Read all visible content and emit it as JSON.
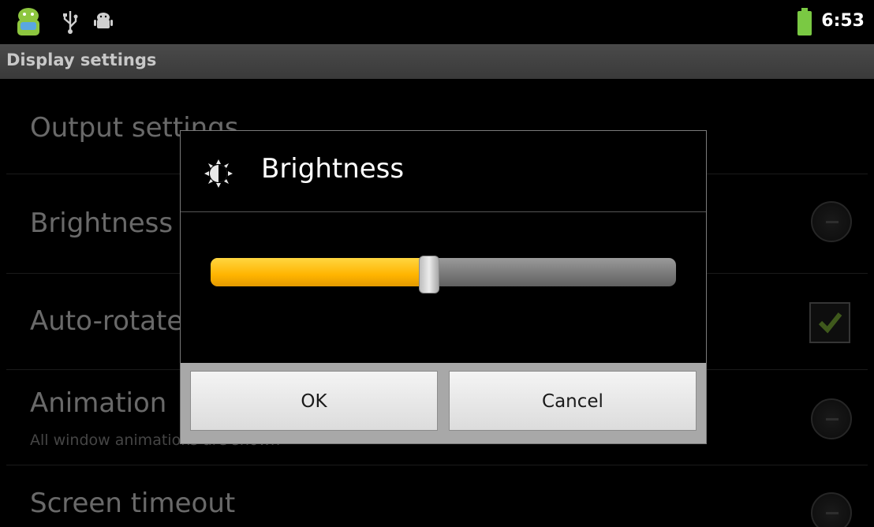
{
  "status_bar": {
    "time": "6:53",
    "icons": [
      "android-robot-icon",
      "usb-icon",
      "android-debug-icon",
      "battery-icon"
    ]
  },
  "title_bar": {
    "title": "Display settings"
  },
  "settings_list": {
    "items": [
      {
        "label": "Output settings"
      },
      {
        "label": "Brightness",
        "control": "more-icon"
      },
      {
        "label": "Auto-rotate screen",
        "control": "checkbox",
        "checked": true
      },
      {
        "label": "Animation",
        "summary": "All window animations are shown",
        "control": "more-icon"
      },
      {
        "label": "Screen timeout",
        "control": "more-icon"
      }
    ]
  },
  "dialog": {
    "icon": "brightness-icon",
    "title": "Brightness",
    "slider": {
      "value": 0.47
    },
    "ok_label": "OK",
    "cancel_label": "Cancel"
  },
  "colors": {
    "accent_fill": "#ffb400",
    "title_bar_bg": "#3e3e3e",
    "battery": "#7ac943"
  }
}
